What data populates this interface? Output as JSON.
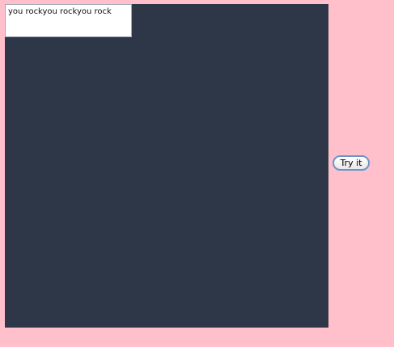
{
  "text_box": {
    "content": "you rockyou rockyou rock"
  },
  "try_button": {
    "label": "Try it"
  },
  "colors": {
    "page_background": "#ffc0cb",
    "panel_background": "#2d3748",
    "button_border": "#6c95c9"
  }
}
